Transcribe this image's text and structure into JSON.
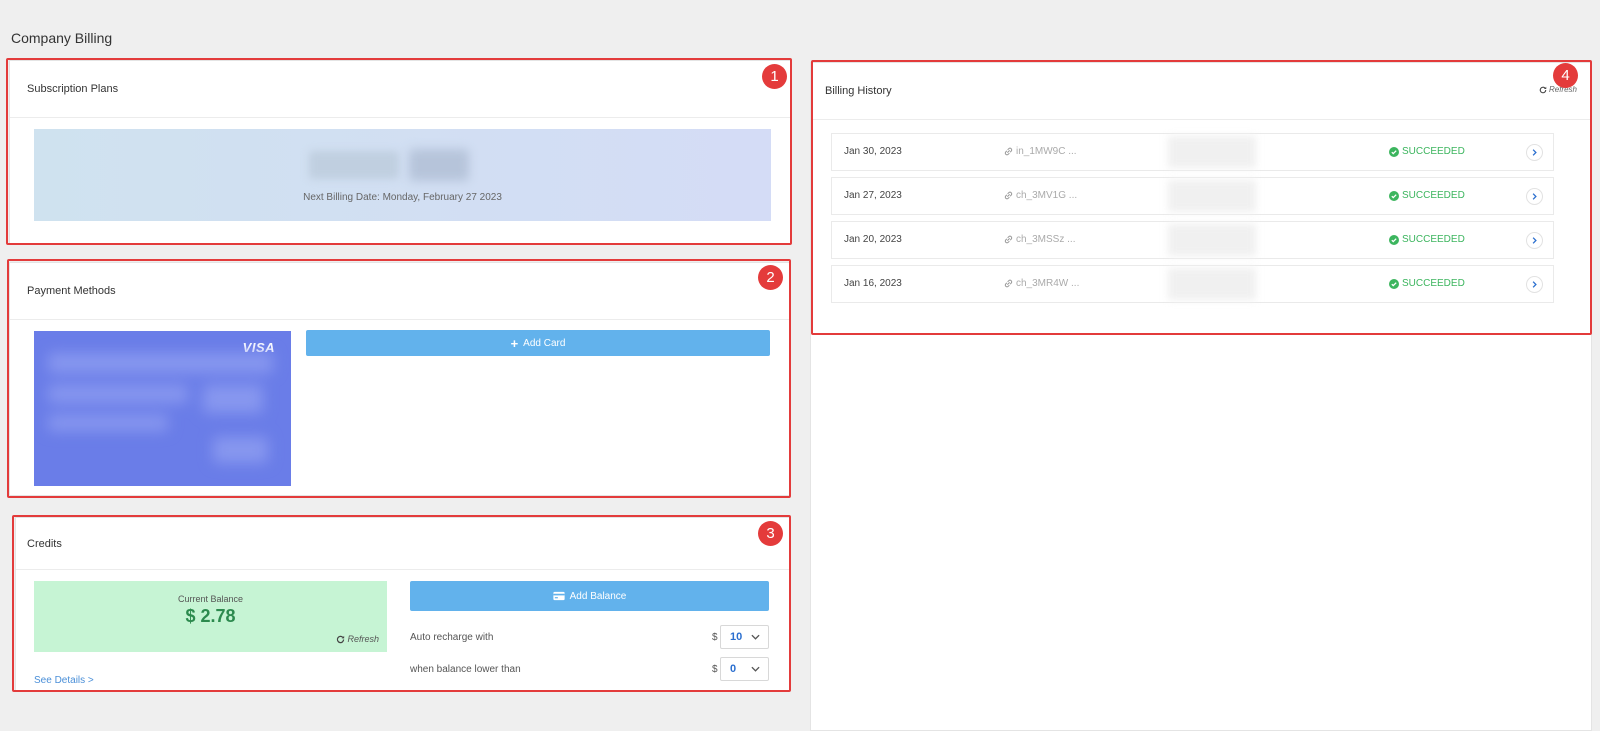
{
  "page": {
    "title": "Company Billing"
  },
  "annotations": [
    "1",
    "2",
    "3",
    "4"
  ],
  "subscription": {
    "title": "Subscription Plans",
    "next_billing": "Next Billing Date: Monday, February 27 2023"
  },
  "payment": {
    "title": "Payment Methods",
    "card_brand": "VISA",
    "add_card_label": "Add Card"
  },
  "credits": {
    "title": "Credits",
    "current_balance_label": "Current Balance",
    "current_balance_value": "$ 2.78",
    "refresh_label": "Refresh",
    "see_details_label": "See Details >",
    "add_balance_label": "Add Balance",
    "auto_recharge_label": "Auto recharge with",
    "auto_recharge_currency": "$",
    "auto_recharge_value": "10",
    "threshold_label": "when balance lower than",
    "threshold_currency": "$",
    "threshold_value": "0"
  },
  "billing_history": {
    "title": "Billing History",
    "refresh_label": "Refresh",
    "rows": [
      {
        "date": "Jan 30, 2023",
        "id": "in_1MW9C ...",
        "status": "SUCCEEDED"
      },
      {
        "date": "Jan 27, 2023",
        "id": "ch_3MV1G ...",
        "status": "SUCCEEDED"
      },
      {
        "date": "Jan 20, 2023",
        "id": "ch_3MSSz ...",
        "status": "SUCCEEDED"
      },
      {
        "date": "Jan 16, 2023",
        "id": "ch_3MR4W ...",
        "status": "SUCCEEDED"
      }
    ]
  },
  "colors": {
    "accent_button": "#62b2ec",
    "success": "#3cb55e",
    "annotation": "#e33b3b",
    "balance_bg": "#c6f4d4",
    "card_bg": "#6a7de8"
  }
}
